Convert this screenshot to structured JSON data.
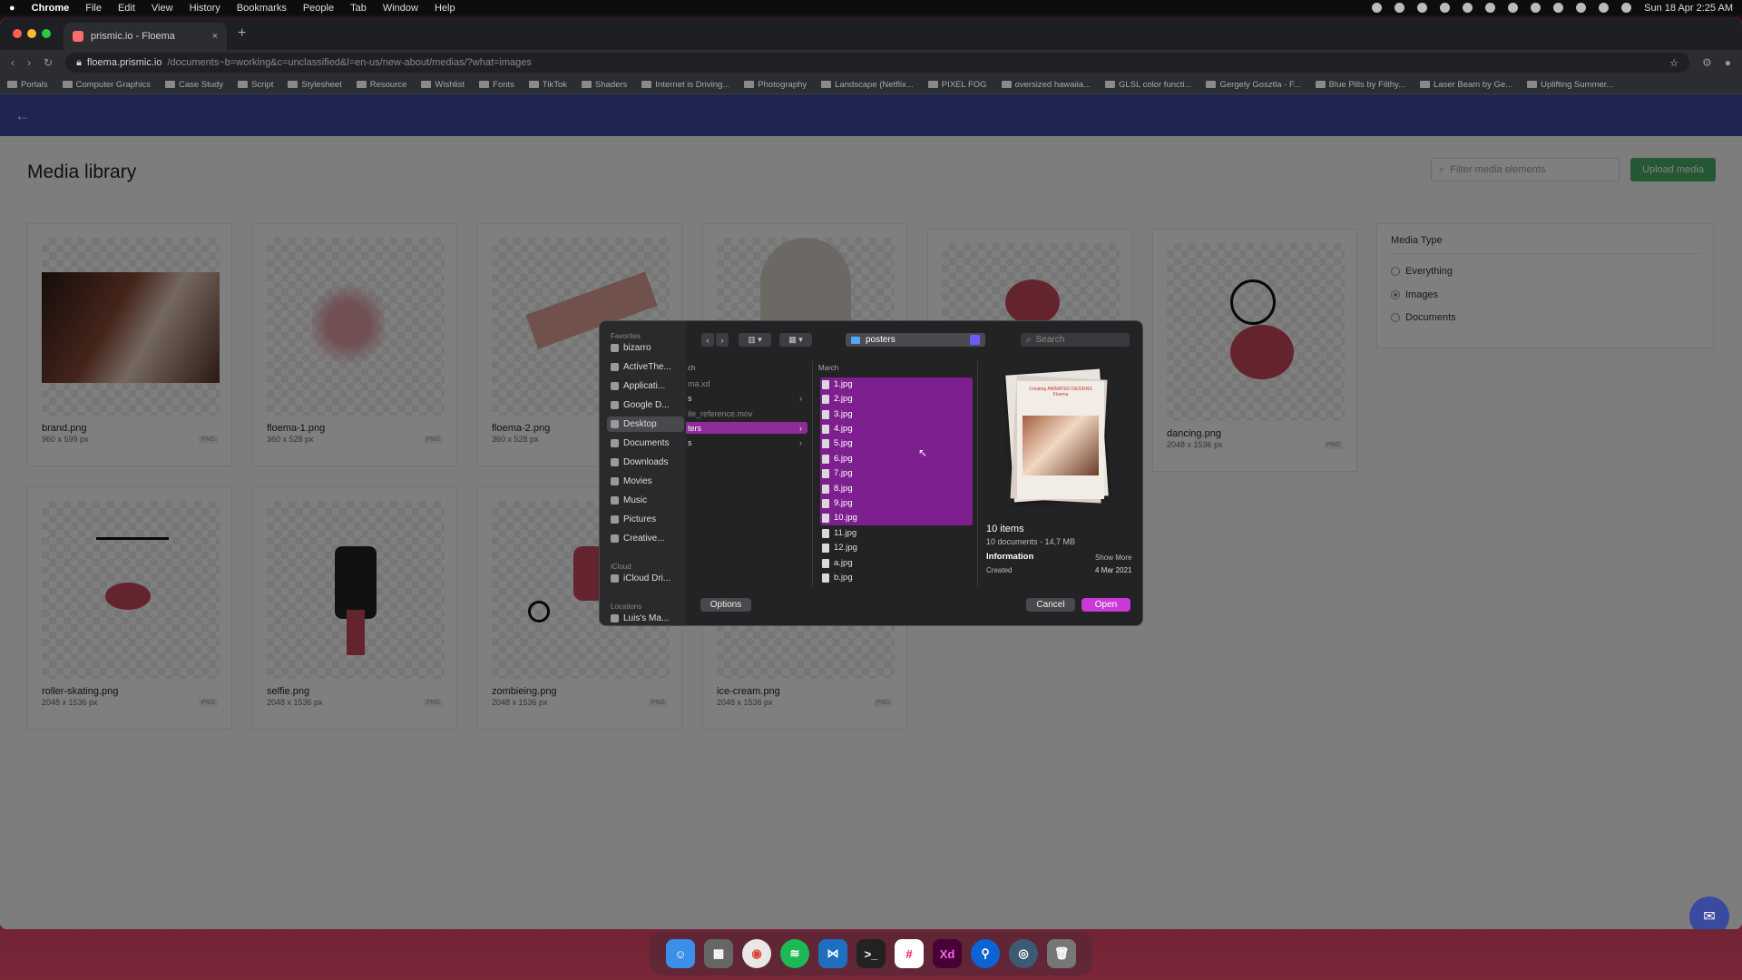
{
  "menubar": {
    "apple": "",
    "items": [
      "Chrome",
      "File",
      "Edit",
      "View",
      "History",
      "Bookmarks",
      "People",
      "Tab",
      "Window",
      "Help"
    ],
    "clock": "Sun 18 Apr  2:25 AM"
  },
  "browser": {
    "tab_title": "prismic.io - Floema",
    "url_host": "floema.prismic.io",
    "url_path": "/documents~b=working&c=unclassified&l=en-us/new-about/medias/?what=images",
    "bookmarks": [
      "Portals",
      "Computer Graphics",
      "Case Study",
      "Script",
      "Stylesheet",
      "Resource",
      "Wishlist",
      "Fonts",
      "TikTok",
      "Shaders",
      "Internet is Driving...",
      "Photography",
      "Landscape (Netflix...",
      "PIXEL FOG",
      "oversized hawaiia...",
      "GLSL color functi...",
      "Gergely Gosztla - F...",
      "Blue Pills by Filthy...",
      "Laser Beam by Ge...",
      "Uplifting Summer..."
    ]
  },
  "app": {
    "back_glyph": "←",
    "title": "Media library",
    "filter_placeholder": "Filter media elements",
    "upload_label": "Upload media",
    "media_type": {
      "heading": "Media Type",
      "options": [
        "Everything",
        "Images",
        "Documents"
      ],
      "selected": "Images"
    },
    "cards": [
      {
        "name": "brand.png",
        "dims": "960 x 599 px",
        "type": "PNG"
      },
      {
        "name": "floema-1.png",
        "dims": "360 x 528 px",
        "type": "PNG"
      },
      {
        "name": "floema-2.png",
        "dims": "360 x 528 px",
        "type": "PNG"
      },
      {
        "name": "dancing.png",
        "dims": "2048 x 1536 px",
        "type": "PNG"
      },
      {
        "name": "roller-skating.png",
        "dims": "2048 x 1536 px",
        "type": "PNG"
      },
      {
        "name": "selfie.png",
        "dims": "2048 x 1536 px",
        "type": "PNG"
      },
      {
        "name": "zombieing.png",
        "dims": "2048 x 1536 px",
        "type": "PNG"
      },
      {
        "name": "ice-cream.png",
        "dims": "2048 x 1536 px",
        "type": "PNG"
      }
    ]
  },
  "dialog": {
    "favorites_label": "Favorites",
    "favorites": [
      "bizarro",
      "ActiveThe...",
      "Applicati...",
      "Google D...",
      "Desktop",
      "Documents",
      "Downloads",
      "Movies",
      "Music",
      "Pictures",
      "Creative..."
    ],
    "selected_favorite": "Desktop",
    "icloud_label": "iCloud",
    "icloud_items": [
      "iCloud Dri..."
    ],
    "locations_label": "Locations",
    "location_items": [
      "Luis's Ma..."
    ],
    "path_folder": "posters",
    "search_placeholder": "Search",
    "col1_header": "ch",
    "col1_rows": [
      "ma.xd",
      "s",
      "ile_reference.mov",
      "ters",
      "s"
    ],
    "col1_selected": "ters",
    "col2_header": "March",
    "files_selected": [
      "1.jpg",
      "2.jpg",
      "3.jpg",
      "4.jpg",
      "5.jpg",
      "6.jpg",
      "7.jpg",
      "8.jpg",
      "9.jpg",
      "10.jpg"
    ],
    "files_other": [
      "11.jpg",
      "12.jpg",
      "a.jpg",
      "b.jpg"
    ],
    "preview": {
      "poster_text": "Creating ANIMATED DESIGNS Floema",
      "count": "10 items",
      "summary": "10 documents - 14,7 MB",
      "info_label": "Information",
      "show_more": "Show More",
      "created_label": "Created",
      "created_value": "4 Mar 2021"
    },
    "options_label": "Options",
    "cancel_label": "Cancel",
    "open_label": "Open",
    "accent": "#c93ad6"
  },
  "dock": {
    "apps": [
      "Finder",
      "Launchpad",
      "Chrome",
      "Spotify",
      "VS Code",
      "Terminal",
      "Slack",
      "Xd",
      "Maps",
      "Proxyman",
      "Trash"
    ]
  }
}
